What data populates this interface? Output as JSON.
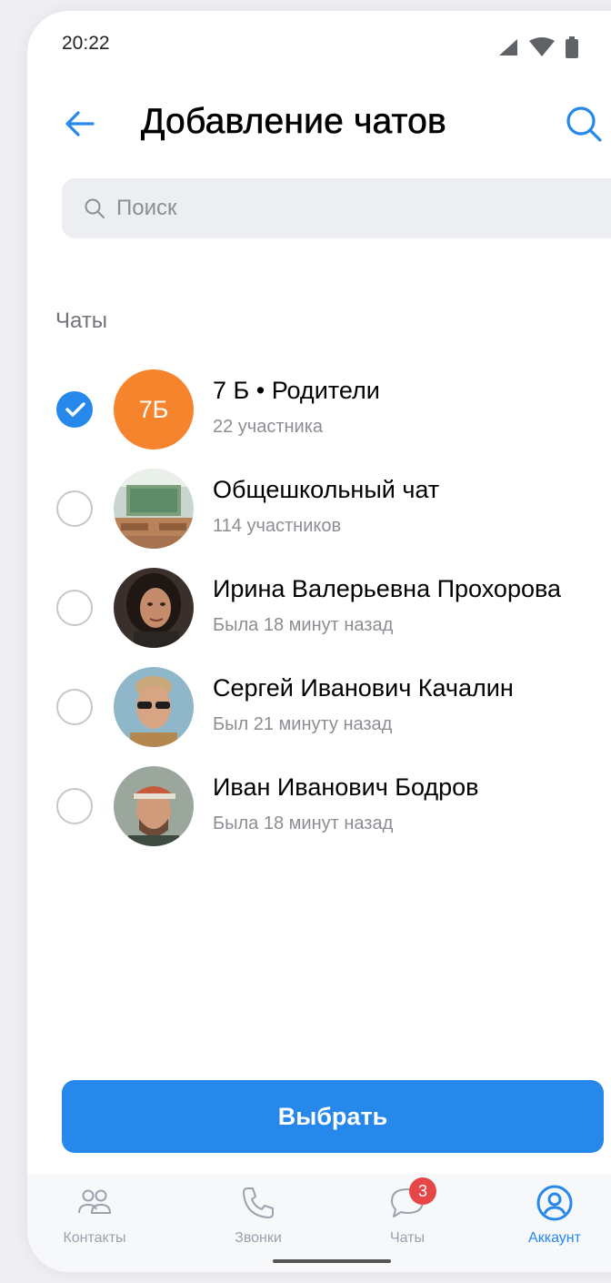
{
  "status_bar": {
    "time": "20:22"
  },
  "header": {
    "title": "Добавление чатов"
  },
  "search": {
    "placeholder": "Поиск",
    "value": ""
  },
  "section": {
    "label": "Чаты"
  },
  "chats": [
    {
      "name": "7 Б • Родители",
      "subtitle": "22 участника",
      "avatar_initials": "7Б",
      "selected": true
    },
    {
      "name": "Общешкольный чат",
      "subtitle": "114 участников",
      "avatar": "classroom-photo",
      "selected": false
    },
    {
      "name": "Ирина Валерьевна Прохорова",
      "subtitle": "Была 18 минут назад",
      "avatar": "woman-photo",
      "selected": false
    },
    {
      "name": "Сергей Иванович Качалин",
      "subtitle": "Был 21 минуту назад",
      "avatar": "man-sunglasses-photo",
      "selected": false
    },
    {
      "name": "Иван Иванович Бодров",
      "subtitle": "Была 18 минут назад",
      "avatar": "man-cap-photo",
      "selected": false
    }
  ],
  "primary_action": {
    "label": "Выбрать"
  },
  "tabbar": {
    "tabs": [
      {
        "label": "Контакты",
        "icon": "contacts-icon",
        "active": false
      },
      {
        "label": "Звонки",
        "icon": "phone-icon",
        "active": false
      },
      {
        "label": "Чаты",
        "icon": "chat-bubble-icon",
        "active": false,
        "badge": "3"
      },
      {
        "label": "Аккаунт",
        "icon": "account-icon",
        "active": true
      }
    ]
  },
  "colors": {
    "accent": "#2688eb",
    "badge": "#e64646",
    "avatar_initials_bg": "#f5842d",
    "secondary_text": "#8b8e93"
  }
}
